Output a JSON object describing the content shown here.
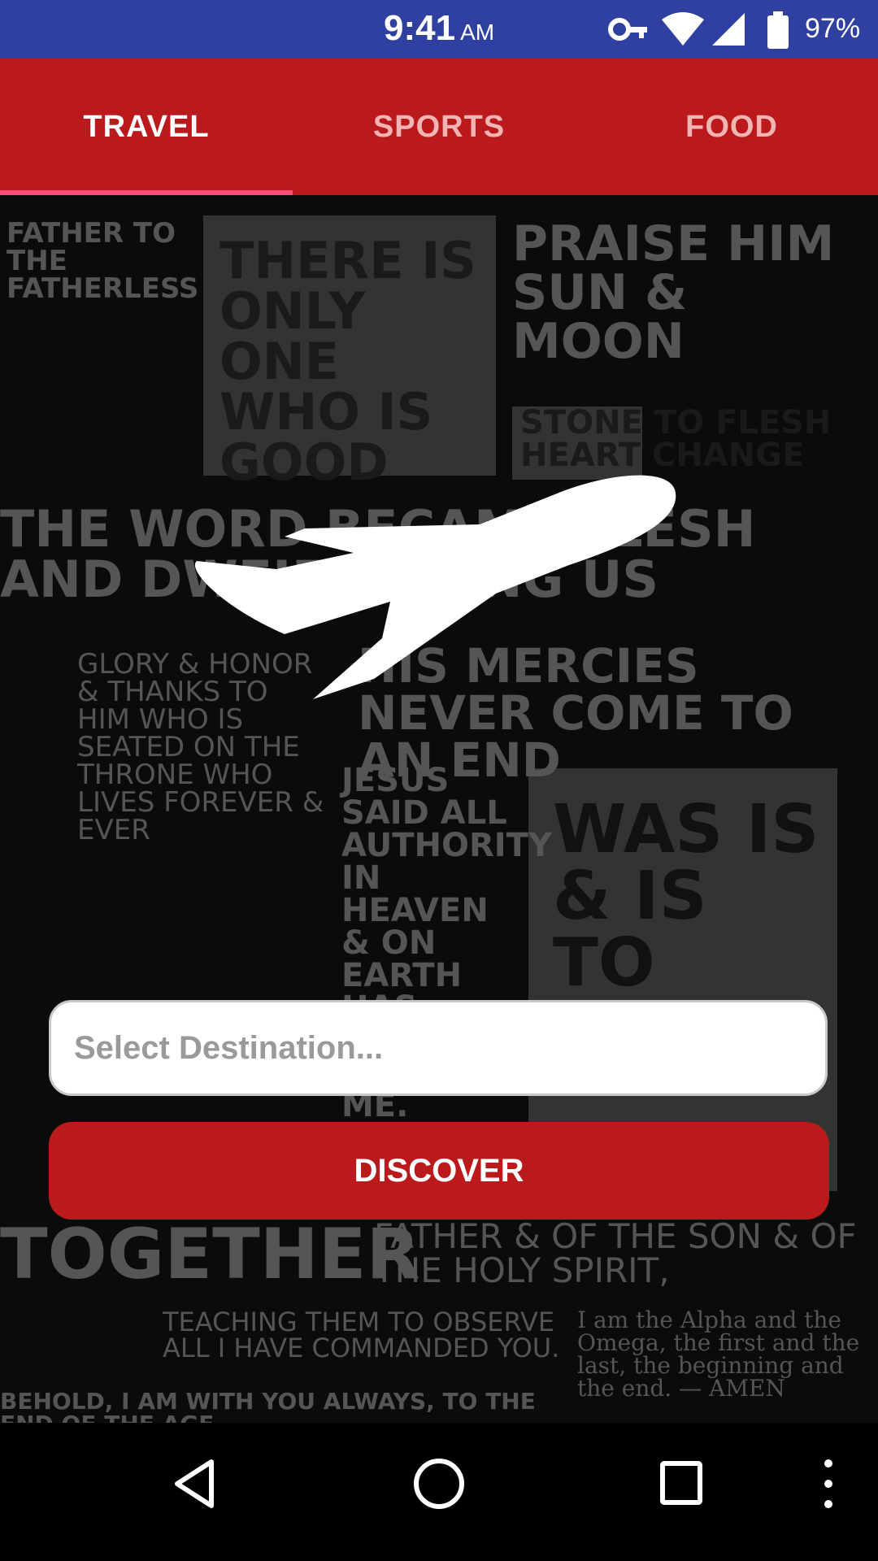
{
  "status_bar": {
    "time": "9:41",
    "ampm": "AM",
    "battery": "97%",
    "icons": [
      "key-icon",
      "wifi-icon",
      "signal-icon",
      "battery-icon"
    ]
  },
  "tabs": [
    {
      "label": "TRAVEL",
      "active": true
    },
    {
      "label": "SPORTS",
      "active": false
    },
    {
      "label": "FOOD",
      "active": false
    }
  ],
  "form": {
    "destination_placeholder": "Select Destination...",
    "destination_value": "",
    "discover_label": "DISCOVER"
  },
  "background_text": {
    "line1": "FATHER TO THE FATHERLESS",
    "line2": "THERE IS ONLY ONE WHO IS GOOD",
    "line3": "PRAISE HIM SUN & MOON",
    "line4": "STONE TO FLESH HEART CHANGE",
    "line5": "THE WORD BECAME FLESH AND DWELT AMONG US",
    "line6": "HIS MERCIES NEVER COME TO AN END",
    "line7": "GLORY & HONOR & THANKS TO HIM WHO IS SEATED ON THE THRONE WHO LIVES FOREVER & EVER",
    "line8": "JESUS SAID ALL AUTHORITY IN HEAVEN & ON EARTH HAS BEEN GIVEN TO ME.",
    "line9": "WAS IS & IS TO COME",
    "line10": "FATHER & OF THE SON & OF THE HOLY SPIRIT,",
    "line11": "TOGETHER",
    "line12": "TEACHING THEM TO OBSERVE ALL I HAVE COMMANDED YOU.",
    "line13": "I am the Alpha and the Omega, the first and the last, the beginning and the end. — AMEN",
    "line14": "BEHOLD, I AM WITH YOU ALWAYS, TO THE END OF THE AGE."
  },
  "colors": {
    "status_bar": "#3040a0",
    "primary": "#bb1a1c",
    "tab_indicator": "#ff4d7a"
  },
  "nav_icons": [
    "back-icon",
    "home-icon",
    "recents-icon",
    "overflow-icon"
  ]
}
